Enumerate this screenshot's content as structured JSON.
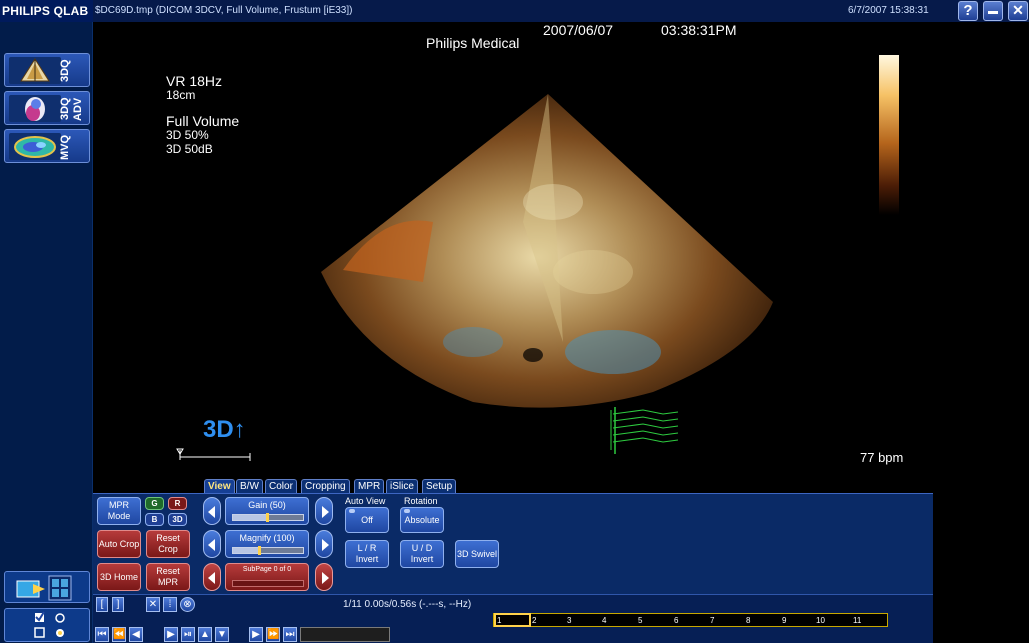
{
  "titlebar": {
    "brand": "PHILIPS QLAB",
    "file_title": "$DC69D.tmp (DICOM 3DCV, Full Volume, Frustum [iE33])",
    "datetime": "6/7/2007 15:38:31",
    "help_label": "?",
    "minimize_label": "▬",
    "close_label": "✕"
  },
  "left_tools": [
    {
      "label": "3DQ",
      "icon": "3d-heart-icon"
    },
    {
      "label": "3DQ ADV",
      "icon": "3d-advanced-icon"
    },
    {
      "label": "MVQ",
      "icon": "mitral-valve-icon"
    }
  ],
  "viewport": {
    "date": "2007/06/07",
    "time": "03:38:31PM",
    "institution": "Philips Medical",
    "frame_rate": "VR 18Hz",
    "depth": "18cm",
    "mode": "Full Volume",
    "setting1": "3D 50%",
    "setting2": "3D 50dB",
    "orientation_marker": "3D↑",
    "heart_rate": "77 bpm"
  },
  "tabs": [
    "View",
    "B/W",
    "Color",
    "Cropping",
    "MPR",
    "iSlice",
    "Setup"
  ],
  "active_tab": "View",
  "controls": {
    "mpr_mode": "MPR Mode",
    "auto_crop": "Auto Crop",
    "reset_crop": "Reset Crop",
    "home_3d": "3D Home",
    "reset_mpr": "Reset MPR",
    "g": "G",
    "r": "R",
    "b": "B",
    "three_d": "3D",
    "gain": {
      "label": "Gain (50)",
      "value": 0.5
    },
    "magnify": {
      "label": "Magnify (100)",
      "value": 0.38
    },
    "subpage": {
      "label": "SubPage 0 of 0",
      "value": 0
    },
    "auto_view_label": "Auto View",
    "auto_view_value": "Off",
    "rotation_label": "Rotation",
    "rotation_value": "Absolute",
    "lr_invert": "L / R Invert",
    "ud_invert": "U / D Invert",
    "swivel_3d": "3D Swivel"
  },
  "playback": {
    "status": "1/11  0.00s/0.56s (-.---s, --Hz)",
    "ticks": [
      "1",
      "2",
      "3",
      "4",
      "5",
      "6",
      "7",
      "8",
      "9",
      "10",
      "11"
    ],
    "current_frame": 1
  },
  "colors": {
    "panel": "#0a2a66",
    "accent": "#ffd24a",
    "ecg": "#2ecc40"
  }
}
